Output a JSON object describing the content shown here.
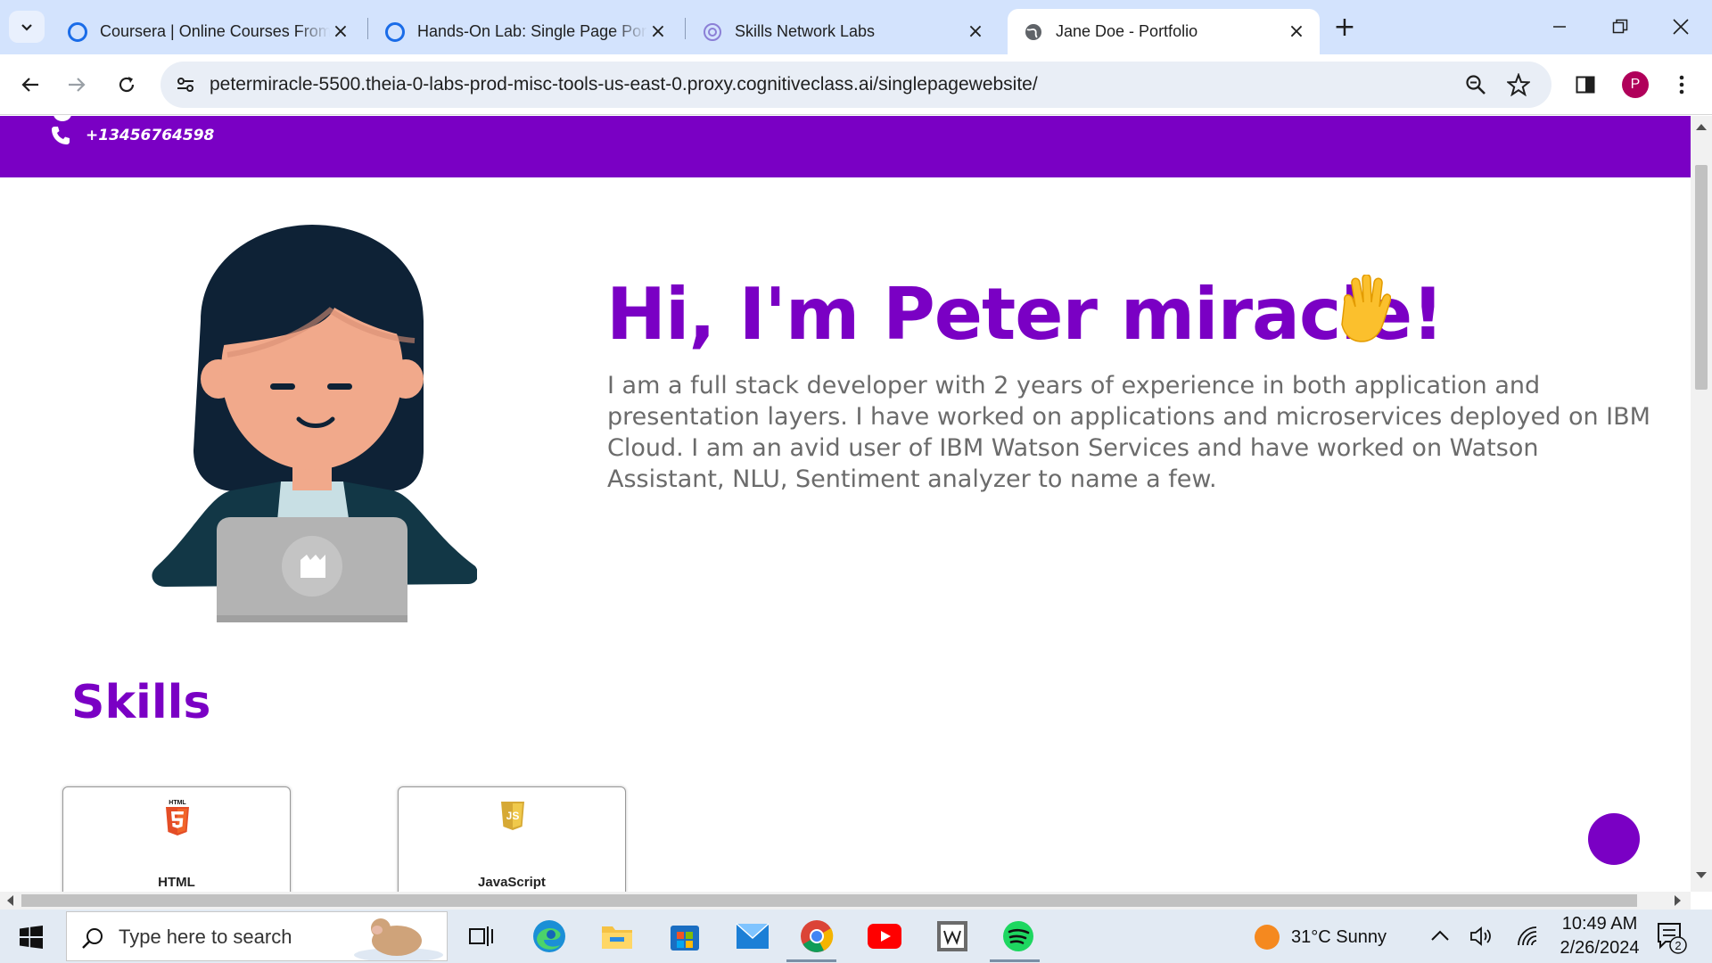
{
  "browser": {
    "tabs": [
      {
        "title": "Coursera | Online Courses From",
        "favicon": "coursera-icon",
        "active": false
      },
      {
        "title": "Hands-On Lab: Single Page Port",
        "favicon": "coursera-icon",
        "active": false
      },
      {
        "title": "Skills Network Labs",
        "favicon": "skills-network-icon",
        "active": false
      },
      {
        "title": "Jane Doe - Portfolio",
        "favicon": "globe-icon",
        "active": true
      }
    ],
    "url": "petermiracle-5500.theia-0-labs-prod-misc-tools-us-east-0.proxy.cognitiveclass.ai/singlepagewebsite/",
    "profile_initial": "P"
  },
  "page": {
    "phone": "+13456764598",
    "hero": {
      "title": "Hi, I'm Peter miracle!",
      "bio": "I am a full stack developer with 2 years of experience in both application and presentation layers. I have worked on applications and microservices deployed on IBM Cloud. I am an avid user of IBM Watson Services and have worked on Watson Assistant, NLU, Sentiment analyzer to name a few."
    },
    "skills": {
      "title": "Skills",
      "items": [
        {
          "label": "HTML",
          "icon": "html5-icon",
          "icon_text": "HTML"
        },
        {
          "label": "JavaScript",
          "icon": "javascript-icon",
          "icon_text": "JS"
        }
      ]
    },
    "accent_color": "#7a00c4"
  },
  "taskbar": {
    "search_placeholder": "Type here to search",
    "weather": "31°C  Sunny",
    "time": "10:49 AM",
    "date": "2/26/2024",
    "notification_count": "2"
  }
}
